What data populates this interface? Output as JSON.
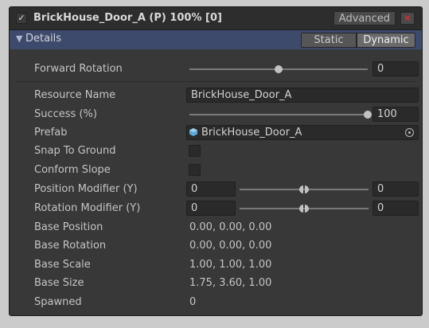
{
  "header": {
    "enabled_check": "✓",
    "title": "BrickHouse_Door_A (P) 100% [0]",
    "advanced_label": "Advanced",
    "close_label": "✕"
  },
  "section": {
    "foldout_glyph": "▼",
    "label": "Details",
    "static_label": "Static",
    "dynamic_label": "Dynamic",
    "selected": "Dynamic"
  },
  "forward_rotation": {
    "label": "Forward Rotation",
    "value": "0",
    "slider_fraction": 0.5
  },
  "resource_name": {
    "label": "Resource Name",
    "value": "BrickHouse_Door_A"
  },
  "success": {
    "label": "Success (%)",
    "value": "100",
    "slider_fraction": 1.0
  },
  "prefab": {
    "label": "Prefab",
    "value": "BrickHouse_Door_A",
    "icon": "prefab-cube-icon"
  },
  "snap_to_ground": {
    "label": "Snap To Ground",
    "checked": false
  },
  "conform_slope": {
    "label": "Conform Slope",
    "checked": false
  },
  "position_modifier": {
    "label": "Position Modifier (Y)",
    "min": "0",
    "max": "0"
  },
  "rotation_modifier": {
    "label": "Rotation Modifier (Y)",
    "min": "0",
    "max": "0"
  },
  "base_position": {
    "label": "Base Position",
    "value": "0.00, 0.00, 0.00"
  },
  "base_rotation": {
    "label": "Base Rotation",
    "value": "0.00, 0.00, 0.00"
  },
  "base_scale": {
    "label": "Base Scale",
    "value": "1.00, 1.00, 1.00"
  },
  "base_size": {
    "label": "Base Size",
    "value": "1.75, 3.60, 1.00"
  },
  "spawned": {
    "label": "Spawned",
    "value": "0"
  },
  "colors": {
    "panel_bg": "#383838",
    "section_bg": "#3e4a6b",
    "close_red": "#e0312a",
    "prefab_icon_blue": "#5fa8d8"
  }
}
